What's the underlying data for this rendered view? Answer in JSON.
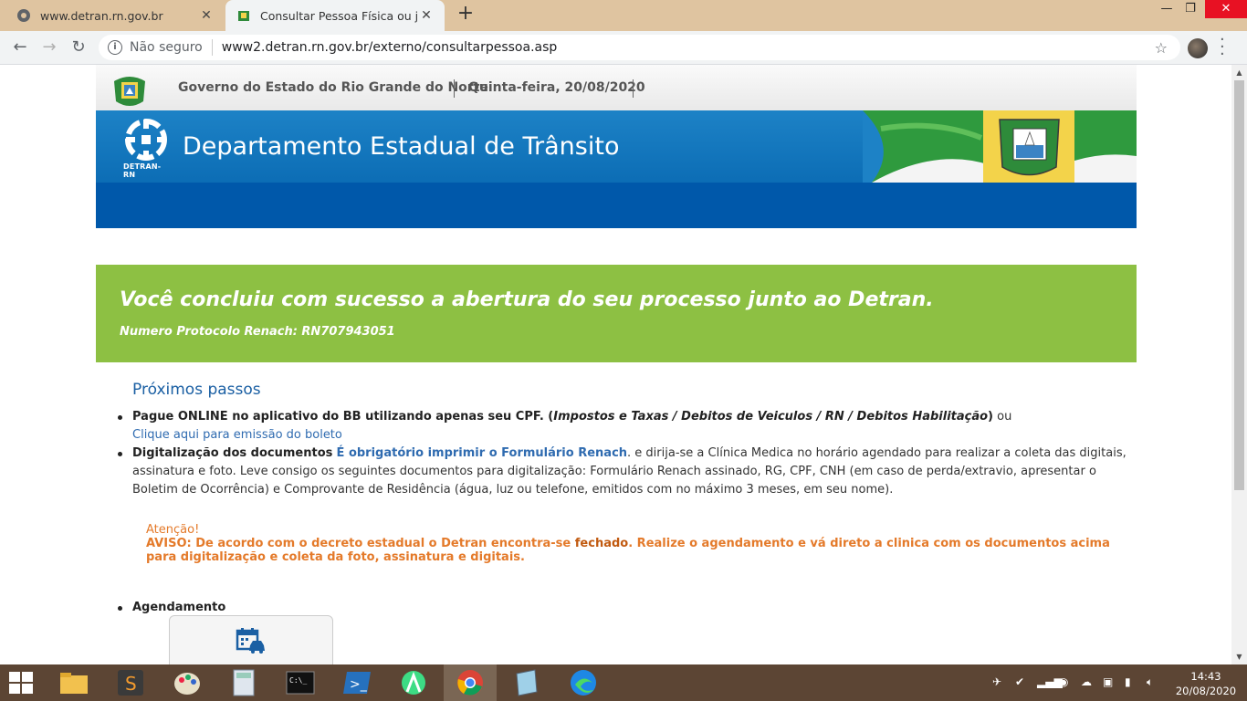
{
  "browser": {
    "tabs": [
      {
        "title": "www.detran.rn.gov.br",
        "icon": "globe-icon"
      },
      {
        "title": "Consultar Pessoa Física ou jurídic",
        "icon": "rn-crest-icon",
        "active": true
      }
    ],
    "security_label": "Não seguro",
    "url": "www2.detran.rn.gov.br/externo/consultarpessoa.asp"
  },
  "header": {
    "gov_text": "Governo do Estado do Rio Grande do Norte",
    "date_text": "Quinta-feira, 20/08/2020"
  },
  "banner": {
    "title": "Departamento Estadual de Trânsito",
    "logo_label": "DETRAN-RN"
  },
  "success": {
    "title": "Você concluiu com sucesso a abertura do seu processo junto ao Detran.",
    "protocol": "Numero Protocolo Renach: RN707943051",
    "color": "#8dc043"
  },
  "next_steps": {
    "heading": "Próximos passos",
    "step1": {
      "bold": "Pague ONLINE no aplicativo do BB utilizando apenas seu CPF. (",
      "italic": "Impostos e Taxas / Debitos de Veiculos / RN / Debitos Habilitação",
      "close": ")",
      "after": " ou",
      "link": "Clique aqui para emissão do boleto"
    },
    "step2": {
      "bold": "Digitalização dos documentos",
      "link": "É obrigatório imprimir o Formulário Renach",
      "text": ". e dirija-se a Clínica Medica no horário agendado para realizar a coleta das digitais, assinatura e foto. Leve consigo os seguintes documentos para digitalização: Formulário Renach assinado, RG, CPF, CNH (em caso de perda/extravio, apresentar o Boletim de Ocorrência) e Comprovante de Residência (água, luz ou telefone, emitidos com no máximo 3 meses, em seu nome)."
    },
    "warning": {
      "attention": "Atenção!",
      "prefix": "AVISO: De acordo com o decreto estadual o Detran encontra-se ",
      "strong": "fechado",
      "suffix": ". Realize o agendamento e vá direto a clinica com os documentos acima para digitalização e coleta da foto, assinatura e digitais."
    },
    "step3": {
      "bold": "Agendamento"
    }
  },
  "taskbar": {
    "time": "14:43",
    "date": "20/08/2020"
  }
}
